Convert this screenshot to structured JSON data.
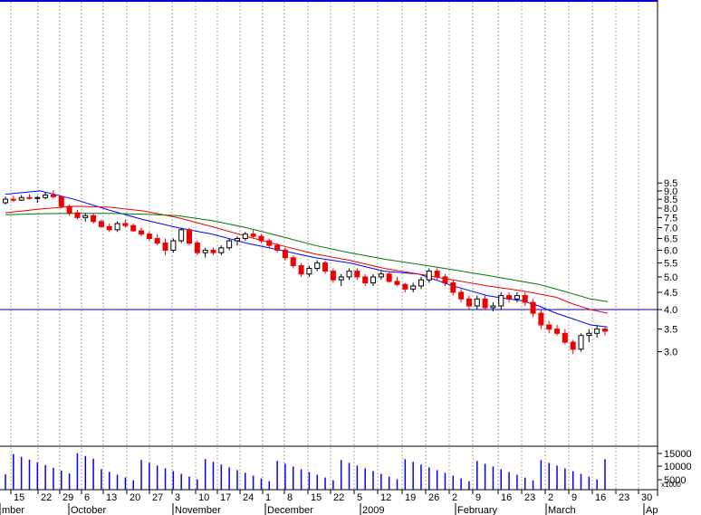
{
  "chart_data": {
    "type": "candlestick",
    "price_axis": {
      "scale": "log",
      "ylim": [
        2.7,
        10.0
      ],
      "ticks": [
        "3.0",
        "3.5",
        "4.0",
        "4.5",
        "5.0",
        "5.5",
        "6.0",
        "6.5",
        "7.0",
        "7.5",
        "8.0",
        "8.5",
        "9.0",
        "9.5"
      ]
    },
    "volume_axis": {
      "ticks": [
        "15000",
        "10000",
        "5000"
      ],
      "multiplier_label": "x1000"
    },
    "x_tick_labels": [
      "15",
      "22",
      "29",
      "6",
      "13",
      "20",
      "27",
      "3",
      "10",
      "17",
      "24",
      "1",
      "8",
      "15",
      "22",
      "5",
      "12",
      "19",
      "26",
      "2",
      "9",
      "16",
      "23",
      "2",
      "9",
      "16",
      "23",
      "30"
    ],
    "month_labels": [
      "mber",
      "October",
      "November",
      "December",
      "2009",
      "February",
      "March",
      "Ap"
    ],
    "horizontal_line": {
      "value": 4.0,
      "color": "#0000cc"
    },
    "colors": {
      "up": "#ffffff",
      "down": "#ee0000",
      "ma_short": "#0000ff",
      "ma_mid": "#ee0000",
      "ma_long": "#007700",
      "volume": "#0000ff",
      "grid": "#aaaaaa"
    },
    "series": [
      {
        "kind": "moving_average",
        "color": "blue",
        "points": [
          [
            0,
            8.8
          ],
          [
            10,
            9.0
          ],
          [
            20,
            8.5
          ],
          [
            30,
            7.9
          ],
          [
            40,
            7.4
          ],
          [
            50,
            7.0
          ],
          [
            60,
            6.7
          ],
          [
            70,
            6.3
          ],
          [
            80,
            6.0
          ],
          [
            90,
            5.7
          ],
          [
            100,
            5.5
          ],
          [
            110,
            5.2
          ],
          [
            120,
            5.1
          ],
          [
            125,
            4.9
          ],
          [
            130,
            4.7
          ],
          [
            135,
            4.55
          ],
          [
            140,
            4.4
          ],
          [
            145,
            4.32
          ],
          [
            150,
            4.25
          ],
          [
            155,
            4.1
          ],
          [
            160,
            3.9
          ],
          [
            165,
            3.75
          ],
          [
            170,
            3.6
          ],
          [
            175,
            3.55
          ]
        ]
      },
      {
        "kind": "moving_average",
        "color": "red",
        "points": [
          [
            0,
            7.75
          ],
          [
            10,
            7.95
          ],
          [
            20,
            8.1
          ],
          [
            30,
            8.05
          ],
          [
            40,
            7.85
          ],
          [
            50,
            7.5
          ],
          [
            60,
            7.05
          ],
          [
            70,
            6.6
          ],
          [
            80,
            6.2
          ],
          [
            90,
            5.85
          ],
          [
            100,
            5.6
          ],
          [
            110,
            5.3
          ],
          [
            120,
            5.1
          ],
          [
            130,
            4.9
          ],
          [
            140,
            4.7
          ],
          [
            150,
            4.55
          ],
          [
            155,
            4.45
          ],
          [
            160,
            4.35
          ],
          [
            165,
            4.15
          ],
          [
            170,
            4.0
          ],
          [
            175,
            3.9
          ]
        ]
      },
      {
        "kind": "moving_average",
        "color": "green",
        "points": [
          [
            0,
            7.65
          ],
          [
            10,
            7.7
          ],
          [
            20,
            7.72
          ],
          [
            30,
            7.72
          ],
          [
            40,
            7.68
          ],
          [
            50,
            7.6
          ],
          [
            60,
            7.35
          ],
          [
            70,
            7.0
          ],
          [
            80,
            6.6
          ],
          [
            90,
            6.2
          ],
          [
            100,
            5.9
          ],
          [
            110,
            5.65
          ],
          [
            120,
            5.45
          ],
          [
            130,
            5.25
          ],
          [
            140,
            5.05
          ],
          [
            150,
            4.85
          ],
          [
            155,
            4.75
          ],
          [
            160,
            4.6
          ],
          [
            165,
            4.45
          ],
          [
            170,
            4.3
          ],
          [
            175,
            4.22
          ]
        ]
      }
    ],
    "candles_ohlc": [
      [
        8.3,
        8.65,
        8.2,
        8.5
      ],
      [
        8.5,
        8.7,
        8.35,
        8.45
      ],
      [
        8.45,
        8.75,
        8.4,
        8.6
      ],
      [
        8.6,
        8.8,
        8.5,
        8.55
      ],
      [
        8.55,
        8.7,
        8.3,
        8.6
      ],
      [
        8.6,
        8.9,
        8.5,
        8.75
      ],
      [
        8.75,
        9.05,
        8.55,
        8.65
      ],
      [
        8.65,
        8.7,
        8.0,
        8.1
      ],
      [
        8.1,
        8.2,
        7.6,
        7.75
      ],
      [
        7.75,
        7.9,
        7.4,
        7.5
      ],
      [
        7.5,
        7.7,
        7.3,
        7.6
      ],
      [
        7.6,
        7.7,
        7.2,
        7.3
      ],
      [
        7.3,
        7.4,
        7.0,
        7.05
      ],
      [
        7.05,
        7.2,
        6.8,
        6.9
      ],
      [
        6.9,
        7.3,
        6.8,
        7.2
      ],
      [
        7.2,
        7.4,
        7.0,
        7.1
      ],
      [
        7.1,
        7.2,
        6.8,
        6.85
      ],
      [
        6.85,
        7.0,
        6.6,
        6.7
      ],
      [
        6.7,
        6.8,
        6.4,
        6.5
      ],
      [
        6.5,
        6.7,
        6.2,
        6.3
      ],
      [
        6.3,
        6.5,
        5.8,
        6.0
      ],
      [
        6.0,
        6.5,
        5.9,
        6.4
      ],
      [
        6.4,
        7.0,
        6.3,
        6.9
      ],
      [
        6.9,
        7.0,
        6.2,
        6.3
      ],
      [
        6.3,
        6.4,
        5.8,
        5.9
      ],
      [
        5.9,
        6.1,
        5.7,
        6.0
      ],
      [
        6.0,
        6.1,
        5.8,
        5.9
      ],
      [
        5.9,
        6.2,
        5.8,
        6.1
      ],
      [
        6.1,
        6.5,
        6.0,
        6.4
      ],
      [
        6.4,
        6.6,
        6.2,
        6.5
      ],
      [
        6.5,
        6.8,
        6.4,
        6.7
      ],
      [
        6.7,
        6.9,
        6.5,
        6.6
      ],
      [
        6.6,
        6.7,
        6.3,
        6.4
      ],
      [
        6.4,
        6.5,
        6.1,
        6.2
      ],
      [
        6.2,
        6.3,
        5.9,
        6.0
      ],
      [
        6.0,
        6.1,
        5.6,
        5.7
      ],
      [
        5.7,
        5.8,
        5.3,
        5.4
      ],
      [
        5.4,
        5.5,
        5.0,
        5.1
      ],
      [
        5.1,
        5.4,
        5.0,
        5.3
      ],
      [
        5.3,
        5.6,
        5.2,
        5.5
      ],
      [
        5.5,
        5.6,
        5.1,
        5.2
      ],
      [
        5.2,
        5.3,
        4.8,
        4.9
      ],
      [
        4.9,
        5.1,
        4.7,
        5.0
      ],
      [
        5.0,
        5.3,
        4.9,
        5.2
      ],
      [
        5.2,
        5.3,
        4.9,
        5.0
      ],
      [
        5.0,
        5.1,
        4.7,
        4.8
      ],
      [
        4.8,
        5.1,
        4.7,
        5.0
      ],
      [
        5.0,
        5.2,
        4.9,
        5.1
      ],
      [
        5.1,
        5.2,
        4.8,
        4.85
      ],
      [
        4.85,
        5.0,
        4.7,
        4.75
      ],
      [
        4.75,
        4.8,
        4.5,
        4.6
      ],
      [
        4.6,
        4.8,
        4.5,
        4.7
      ],
      [
        4.7,
        5.0,
        4.6,
        4.9
      ],
      [
        4.9,
        5.3,
        4.8,
        5.2
      ],
      [
        5.2,
        5.3,
        4.9,
        5.0
      ],
      [
        5.0,
        5.1,
        4.7,
        4.8
      ],
      [
        4.8,
        4.9,
        4.4,
        4.5
      ],
      [
        4.5,
        4.6,
        4.2,
        4.3
      ],
      [
        4.3,
        4.4,
        4.0,
        4.1
      ],
      [
        4.1,
        4.4,
        4.0,
        4.3
      ],
      [
        4.3,
        4.4,
        4.0,
        4.05
      ],
      [
        4.05,
        4.2,
        3.95,
        4.1
      ],
      [
        4.1,
        4.5,
        4.0,
        4.4
      ],
      [
        4.4,
        4.5,
        4.2,
        4.3
      ],
      [
        4.3,
        4.5,
        4.2,
        4.4
      ],
      [
        4.4,
        4.5,
        4.1,
        4.2
      ],
      [
        4.2,
        4.3,
        3.8,
        3.9
      ],
      [
        3.9,
        4.0,
        3.5,
        3.6
      ],
      [
        3.6,
        3.7,
        3.4,
        3.5
      ],
      [
        3.5,
        3.6,
        3.35,
        3.4
      ],
      [
        3.4,
        3.5,
        3.15,
        3.2
      ],
      [
        3.2,
        3.25,
        2.95,
        3.05
      ],
      [
        3.05,
        3.4,
        3.0,
        3.35
      ],
      [
        3.35,
        3.5,
        3.2,
        3.4
      ],
      [
        3.4,
        3.6,
        3.3,
        3.5
      ],
      [
        3.5,
        3.55,
        3.35,
        3.45
      ]
    ]
  }
}
